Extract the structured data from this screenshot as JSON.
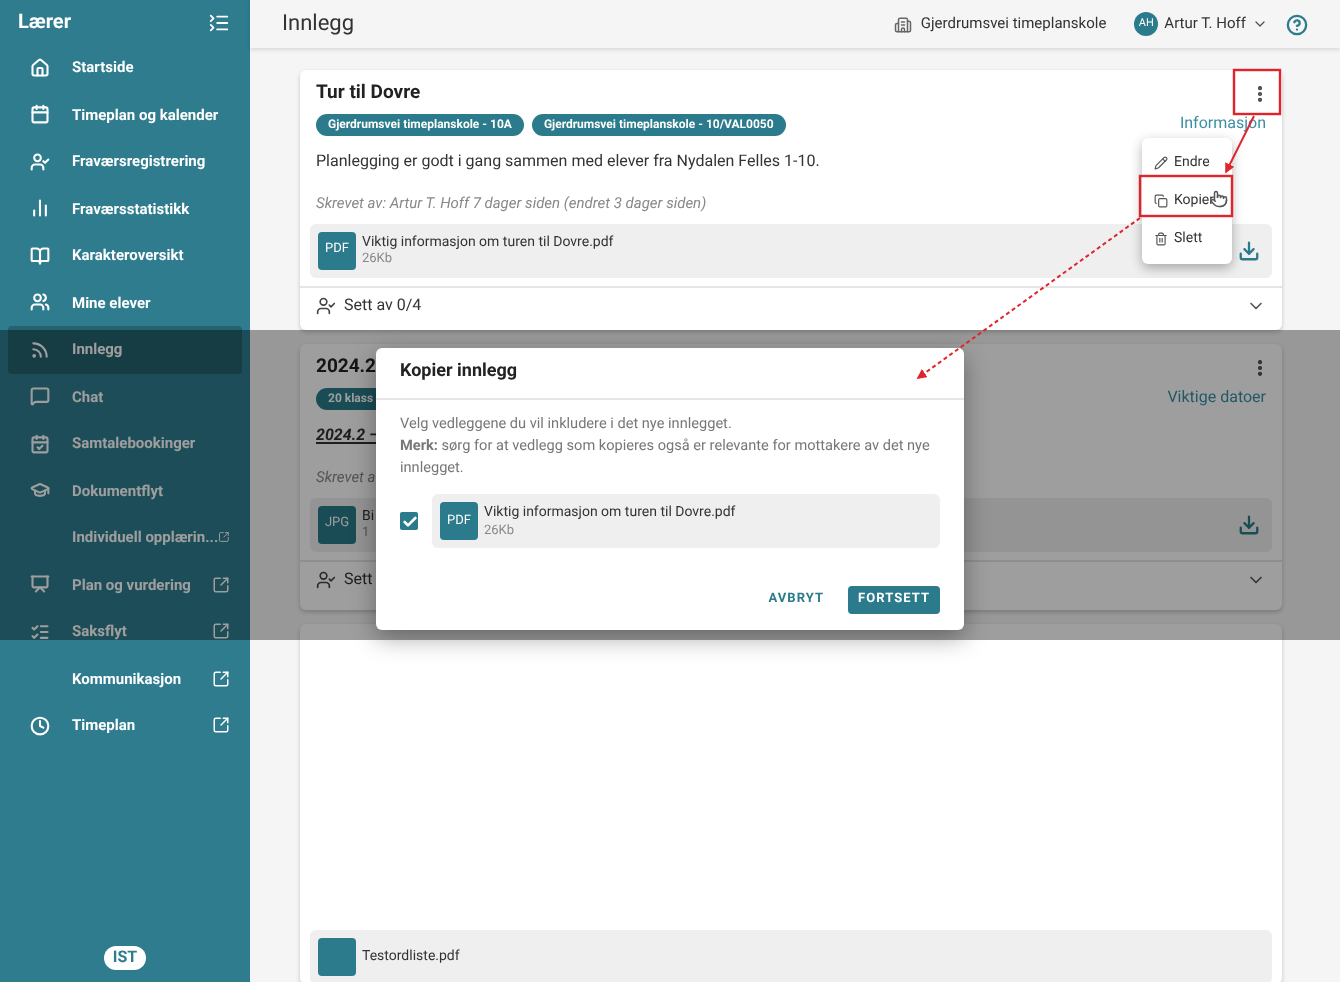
{
  "sidebar": {
    "title": "Lærer",
    "logo": "IST",
    "items": [
      {
        "label": "Startside",
        "external": false,
        "selected": false
      },
      {
        "label": "Timeplan og kalender",
        "external": false,
        "selected": false
      },
      {
        "label": "Fraværsregistrering",
        "external": false,
        "selected": false
      },
      {
        "label": "Fraværsstatistikk",
        "external": false,
        "selected": false
      },
      {
        "label": "Karakteroversikt",
        "external": false,
        "selected": false
      },
      {
        "label": "Mine elever",
        "external": false,
        "selected": false
      },
      {
        "label": "Innlegg",
        "external": false,
        "selected": true
      },
      {
        "label": "Chat",
        "external": false,
        "selected": false
      },
      {
        "label": "Samtalebookinger",
        "external": false,
        "selected": false
      },
      {
        "label": "Dokumentflyt",
        "external": false,
        "selected": false
      },
      {
        "label": "Individuell opplærin...",
        "external": true,
        "selected": false
      },
      {
        "label": "Plan og vurdering",
        "external": true,
        "selected": false
      },
      {
        "label": "Saksflyt",
        "external": true,
        "selected": false
      },
      {
        "label": "Kommunikasjon",
        "external": true,
        "selected": false
      },
      {
        "label": "Timeplan",
        "external": true,
        "selected": false
      }
    ]
  },
  "header": {
    "title": "Innlegg",
    "school": "Gjerdrumsvei timeplanskole",
    "user": {
      "initials": "AH",
      "name": "Artur T. Hoff"
    }
  },
  "posts": [
    {
      "title": "Tur til Dovre",
      "tags": [
        "Gjerdrumsvei timeplanskole - 10A",
        "Gjerdrumsvei timeplanskole - 10/VAL0050"
      ],
      "link": "Informasjon",
      "body": "Planlegging er godt i gang sammen med elever fra Nydalen Felles 1-10.",
      "byline": "Skrevet av: Artur T. Hoff 7 dager siden (endret 3 dager siden)",
      "attachments": [
        {
          "type": "PDF",
          "name": "Viktig informasjon om turen til Dovre.pdf",
          "size": "26Kb"
        }
      ],
      "seen": "Sett av 0/4"
    },
    {
      "title": "2024.2",
      "tags": [
        "20 klass"
      ],
      "link": "Viktige datoer",
      "body": "2024.2 –",
      "byline": "Skrevet a",
      "attachments": [
        {
          "type": "JPG",
          "name": "Bi",
          "size": "1"
        }
      ],
      "seen": "Sett"
    },
    {
      "attachments": [
        {
          "name": "Testordliste.pdf"
        }
      ]
    }
  ],
  "post_menu": {
    "items": [
      {
        "label": "Endre"
      },
      {
        "label": "Kopier"
      },
      {
        "label": "Slett"
      }
    ]
  },
  "dialog": {
    "title": "Kopier innlegg",
    "text": "Velg vedleggene du vil inkludere i det nye innlegget.",
    "note": "**Merk:** sørg for at vedlegg som kopieres også er relevante for mottakere av det nye innlegget.",
    "attachments": [
      {
        "type": "PDF",
        "name": "Viktig informasjon om turen til Dovre.pdf",
        "size": "26Kb",
        "checked": true
      }
    ],
    "cancel": "AVBRYT",
    "confirm": "FORTSETT"
  }
}
